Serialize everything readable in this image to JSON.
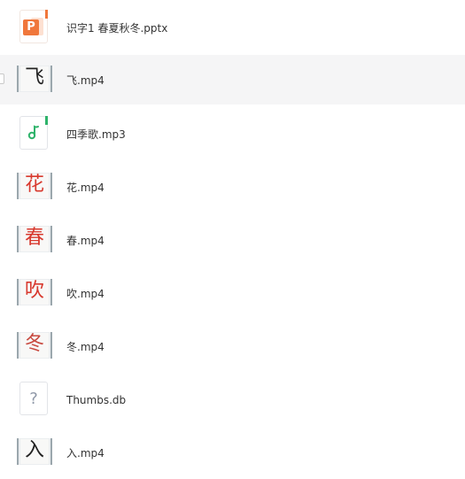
{
  "files": [
    {
      "name": "识字1 春夏秋冬.pptx",
      "type": "ppt",
      "icon": "ppt-icon"
    },
    {
      "name": "飞.mp4",
      "type": "video",
      "thumb_char": "飞",
      "icon": "video-thumbnail",
      "hovered": true
    },
    {
      "name": "四季歌.mp3",
      "type": "audio",
      "icon": "music-note-icon"
    },
    {
      "name": "花.mp4",
      "type": "video",
      "thumb_char": "花",
      "icon": "video-thumbnail"
    },
    {
      "name": "春.mp4",
      "type": "video",
      "thumb_char": "春",
      "icon": "video-thumbnail"
    },
    {
      "name": "吹.mp4",
      "type": "video",
      "thumb_char": "吹",
      "icon": "video-thumbnail"
    },
    {
      "name": "冬.mp4",
      "type": "video",
      "thumb_char": "冬",
      "icon": "video-thumbnail"
    },
    {
      "name": "Thumbs.db",
      "type": "unknown",
      "icon": "question-mark-icon"
    },
    {
      "name": "入.mp4",
      "type": "video",
      "thumb_char": "入",
      "icon": "video-thumbnail"
    }
  ],
  "colors": {
    "ppt_accent": "#f0773c",
    "audio_accent": "#2fb36b",
    "stroke_red": "#d8392e",
    "text": "#333333",
    "hover_bg": "#f5f5f6"
  }
}
